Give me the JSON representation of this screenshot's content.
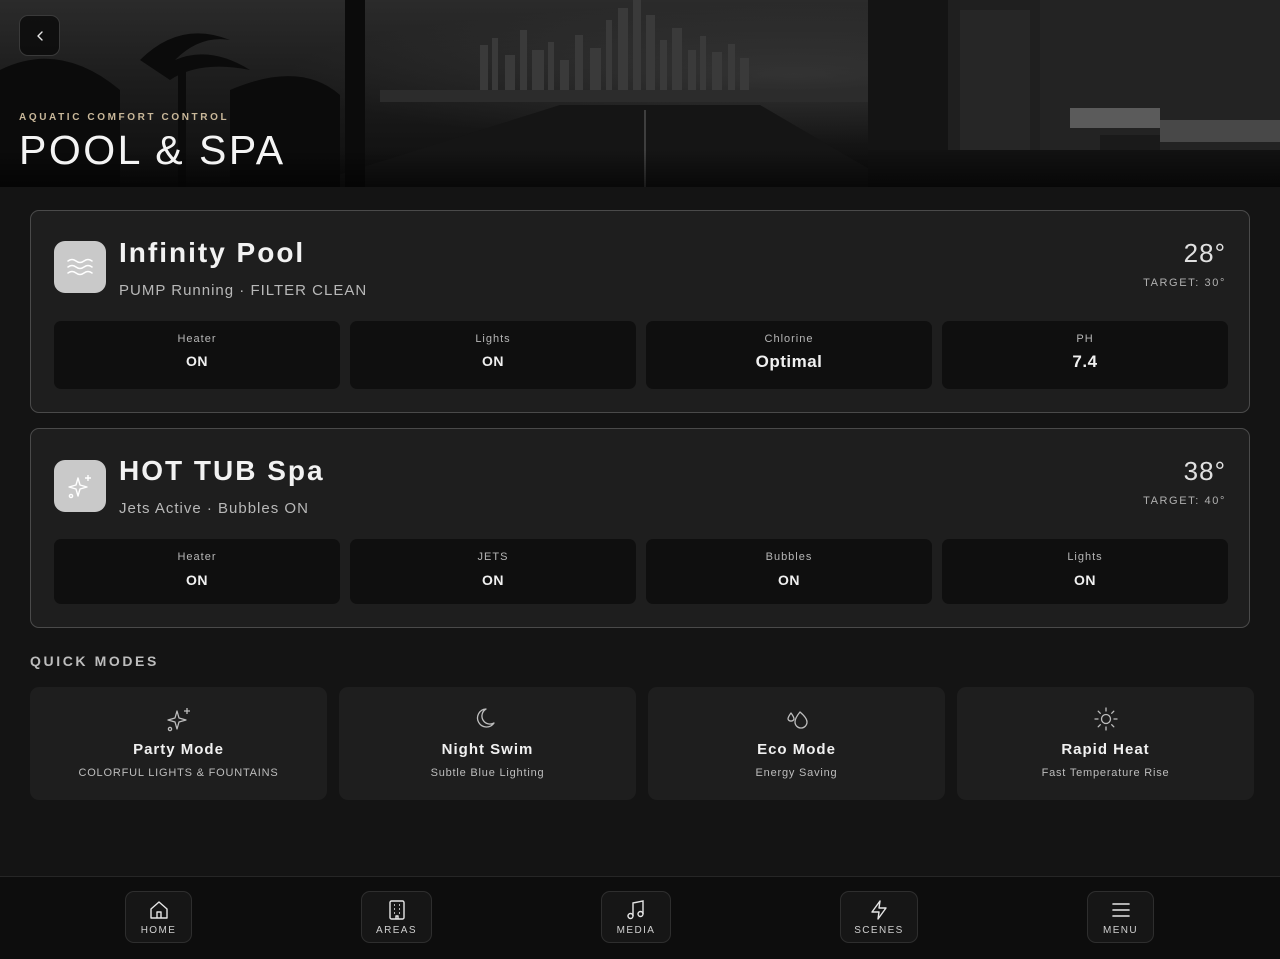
{
  "header": {
    "subtitle": "AQUATIC COMFORT CONTROL",
    "title": "POOL & SPA"
  },
  "pool": {
    "name": "Infinity Pool",
    "status": "PUMP Running · FILTER CLEAN",
    "temp": "28°",
    "target": "TARGET: 30°",
    "icon": "waves-icon",
    "stats": [
      {
        "label": "Heater",
        "value": "ON"
      },
      {
        "label": "Lights",
        "value": "ON"
      },
      {
        "label": "Chlorine",
        "value": "Optimal"
      },
      {
        "label": "PH",
        "value": "7.4"
      }
    ]
  },
  "spa": {
    "name": "HOT TUB Spa",
    "status": "Jets Active · Bubbles ON",
    "temp": "38°",
    "target": "TARGET: 40°",
    "icon": "sparkles-icon",
    "stats": [
      {
        "label": "Heater",
        "value": "ON"
      },
      {
        "label": "JETS",
        "value": "ON"
      },
      {
        "label": "Bubbles",
        "value": "ON"
      },
      {
        "label": "Lights",
        "value": "ON"
      }
    ]
  },
  "quick_modes": {
    "title": "QUICK MODES",
    "items": [
      {
        "name": "Party Mode",
        "desc": "COLORFUL LIGHTS & FOUNTAINS",
        "icon": "sparkles-icon"
      },
      {
        "name": "Night Swim",
        "desc": "Subtle Blue Lighting",
        "icon": "moon-icon"
      },
      {
        "name": "Eco Mode",
        "desc": "Energy Saving",
        "icon": "droplets-icon"
      },
      {
        "name": "Rapid Heat",
        "desc": "Fast Temperature Rise",
        "icon": "sun-icon"
      }
    ]
  },
  "nav": {
    "items": [
      {
        "label": "HOME",
        "icon": "home-icon"
      },
      {
        "label": "AREAS",
        "icon": "building-icon"
      },
      {
        "label": "MEDIA",
        "icon": "music-icon"
      },
      {
        "label": "SCENES",
        "icon": "bolt-icon"
      },
      {
        "label": "MENU",
        "icon": "menu-icon"
      }
    ]
  },
  "colors": {
    "background": "#141414",
    "card": "#1e1e1e",
    "tile": "#0f0f0f",
    "accent_sub": "#c9b89a"
  }
}
